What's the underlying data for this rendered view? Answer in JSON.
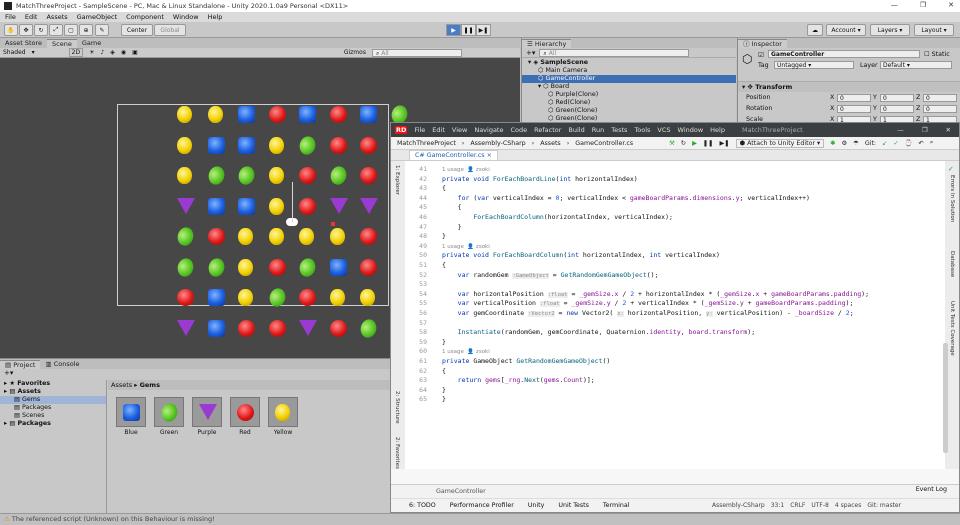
{
  "window": {
    "title": "MatchThreeProject - SampleScene - PC, Mac & Linux Standalone - Unity 2020.1.0a9 Personal <DX11>",
    "controls": [
      "—",
      "❐",
      "✕"
    ]
  },
  "menu": [
    "File",
    "Edit",
    "Assets",
    "GameObject",
    "Component",
    "Window",
    "Help"
  ],
  "toolbar": {
    "center": "Center",
    "global": "Global",
    "account": "Account",
    "layers": "Layers",
    "layout": "Layout"
  },
  "scene_panel": {
    "tabs": [
      "Asset Store",
      "Scene",
      "Game"
    ],
    "shading": "Shaded",
    "mode_2d": "2D",
    "gizmos": "Gizmos",
    "search_placeholder": "All"
  },
  "board": {
    "rows": [
      [
        "yellow",
        "yellow",
        "blue",
        "red",
        "blue",
        "red",
        "blue",
        "green"
      ],
      [
        "yellow",
        "blue",
        "blue",
        "yellow",
        "green",
        "red",
        "red",
        "green"
      ],
      [
        "yellow",
        "green",
        "green",
        "yellow",
        "red",
        "green",
        "red",
        "green"
      ],
      [
        "purple",
        "blue",
        "blue",
        "yellow",
        "red",
        "purple",
        "purple",
        "green"
      ],
      [
        "green",
        "red",
        "yellow",
        "yellow",
        "yellow",
        "yellow",
        "red",
        "blue"
      ],
      [
        "green",
        "green",
        "yellow",
        "red",
        "green",
        "blue",
        "red",
        "blue"
      ],
      [
        "red",
        "blue",
        "yellow",
        "green",
        "red",
        "yellow",
        "yellow",
        "red"
      ],
      [
        "purple",
        "blue",
        "red",
        "red",
        "purple",
        "red",
        "green",
        "yellow"
      ]
    ]
  },
  "hierarchy": {
    "tab": "Hierarchy",
    "search_placeholder": "All",
    "items": [
      {
        "label": "SampleScene",
        "depth": 0,
        "bold": true
      },
      {
        "label": "Main Camera",
        "depth": 1
      },
      {
        "label": "GameController",
        "depth": 1,
        "selected": true
      },
      {
        "label": "Board",
        "depth": 1
      },
      {
        "label": "Purple(Clone)",
        "depth": 2
      },
      {
        "label": "Red(Clone)",
        "depth": 2
      },
      {
        "label": "Green(Clone)",
        "depth": 2
      },
      {
        "label": "Green(Clone)",
        "depth": 2
      }
    ]
  },
  "inspector": {
    "tab": "Inspector",
    "object_name": "GameController",
    "static_label": "Static",
    "tag_label": "Tag",
    "tag_value": "Untagged",
    "layer_label": "Layer",
    "layer_value": "Default",
    "component": "Transform",
    "rows": [
      {
        "label": "Position",
        "x": "0",
        "y": "0",
        "z": "0"
      },
      {
        "label": "Rotation",
        "x": "0",
        "y": "0",
        "z": "0"
      },
      {
        "label": "Scale",
        "x": "1",
        "y": "1",
        "z": "1"
      }
    ],
    "axis": [
      "X",
      "Y",
      "Z"
    ]
  },
  "project": {
    "tabs": [
      "Project",
      "Console"
    ],
    "breadcrumb_root": "Assets",
    "breadcrumb_leaf": "Gems",
    "tree": [
      {
        "label": "Favorites",
        "bold": true,
        "depth": 0
      },
      {
        "label": "Assets",
        "bold": true,
        "depth": 0
      },
      {
        "label": "Gems",
        "depth": 1,
        "selected": true
      },
      {
        "label": "Packages",
        "depth": 1
      },
      {
        "label": "Scenes",
        "depth": 1
      },
      {
        "label": "Packages",
        "bold": true,
        "depth": 0
      }
    ],
    "assets": [
      {
        "name": "Blue",
        "color": "blue"
      },
      {
        "name": "Green",
        "color": "green"
      },
      {
        "name": "Purple",
        "color": "purple"
      },
      {
        "name": "Red",
        "color": "red"
      },
      {
        "name": "Yellow",
        "color": "yellow"
      }
    ]
  },
  "status_message": "The referenced script (Unknown) on this Behaviour is missing!",
  "ide": {
    "menu": [
      "File",
      "Edit",
      "View",
      "Navigate",
      "Code",
      "Refactor",
      "Build",
      "Run",
      "Tests",
      "Tools",
      "VCS",
      "Window",
      "Help"
    ],
    "project": "MatchThreeProject",
    "nav": [
      "MatchThreeProject",
      "Assembly-CSharp",
      "Assets",
      "GameController.cs"
    ],
    "run_config": "Attach to Unity Editor",
    "git_label": "Git:",
    "file_tab": "GameController.cs",
    "breadcrumb_bottom": "GameController",
    "bottom_tabs": [
      "6: TODO",
      "Performance Profiler",
      "Unity",
      "Unit Tests",
      "Terminal"
    ],
    "event_log": "Event Log",
    "status": {
      "assembly": "Assembly-CSharp",
      "pos": "33:1",
      "eol": "CRLF",
      "enc": "UTF-8",
      "indent": "4 spaces",
      "git": "Git: master"
    },
    "side_left": [
      "1: Explorer",
      "2: Structure",
      "2: Favorites"
    ],
    "side_right": [
      "Errors In Solution",
      "Database",
      "Unit Tests Coverage"
    ],
    "code": [
      {
        "n": "41",
        "html": "<span class='cm'>1 usage  &#x1F464; zsoki</span>"
      },
      {
        "n": "42",
        "html": "<span class='kw'>private void</span> <span class='fn'>ForEachBoardLine</span>(<span class='kw'>int</span> horizontalIndex)"
      },
      {
        "n": "43",
        "html": "{"
      },
      {
        "n": "44",
        "html": "    <span class='kw'>for</span> (<span class='kw'>var</span> verticalIndex = <span class='num'>0</span>; verticalIndex &lt; <span class='fld'>gameBoardParams</span>.<span class='fld'>dimensions</span>.<span class='fld'>y</span>; verticalIndex++)"
      },
      {
        "n": "45",
        "html": "    {"
      },
      {
        "n": "46",
        "html": "        <span class='fn'>ForEachBoardColumn</span>(horizontalIndex, verticalIndex);"
      },
      {
        "n": "47",
        "html": "    }"
      },
      {
        "n": "48",
        "html": "}"
      },
      {
        "n": "49",
        "html": "<span class='cm'>1 usage  &#x1F464; zsoki</span>"
      },
      {
        "n": "50",
        "html": "<span class='kw'>private void</span> <span class='fn'>ForEachBoardColumn</span>(<span class='kw'>int</span> horizontalIndex, <span class='kw'>int</span> verticalIndex)"
      },
      {
        "n": "51",
        "html": "{"
      },
      {
        "n": "52",
        "html": "    <span class='kw'>var</span> randomGem <span class='hint'>:GameObject</span> = <span class='fn'>GetRandomGemGameObject</span>();"
      },
      {
        "n": "53",
        "html": ""
      },
      {
        "n": "54",
        "html": "    <span class='kw'>var</span> horizontalPosition <span class='hint'>:float</span> = <span class='fld'>_gemSize</span>.<span class='fld'>x</span> / <span class='num'>2</span> + horizontalIndex * (<span class='fld'>_gemSize</span>.<span class='fld'>x</span> + <span class='fld'>gameBoardParams</span>.<span class='fld'>padding</span>);"
      },
      {
        "n": "55",
        "html": "    <span class='kw'>var</span> verticalPosition <span class='hint'>:float</span> = <span class='fld'>_gemSize</span>.<span class='fld'>y</span> / <span class='num'>2</span> + verticalIndex * (<span class='fld'>_gemSize</span>.<span class='fld'>y</span> + <span class='fld'>gameBoardParams</span>.<span class='fld'>padding</span>);"
      },
      {
        "n": "56",
        "html": "    <span class='kw'>var</span> gemCoordinate <span class='hint'>:Vector2</span> = <span class='kw'>new</span> Vector2( <span class='hint'>x:</span> horizontalPosition, <span class='hint'>y:</span> verticalPosition) - <span class='fld'>_boardSize</span> / <span class='num'>2</span>;"
      },
      {
        "n": "57",
        "html": ""
      },
      {
        "n": "58",
        "html": "    <span class='fn'>Instantiate</span>(randomGem, gemCoordinate, Quaternion.<span class='fld'>identity</span>, <span class='fld'>board</span>.<span class='fld'>transform</span>);"
      },
      {
        "n": "59",
        "html": "}"
      },
      {
        "n": "60",
        "html": "<span class='cm'>1 usage  &#x1F464; zsoki</span>"
      },
      {
        "n": "61",
        "html": "<span class='kw'>private</span> GameObject <span class='fn'>GetRandomGemGameObject</span>()"
      },
      {
        "n": "62",
        "html": "{"
      },
      {
        "n": "63",
        "html": "    <span class='kw'>return</span> <span class='fld'>gems</span>[<span class='fld'>_rng</span>.<span class='fn'>Next</span>(<span class='fld'>gems</span>.<span class='fld'>Count</span>)];"
      },
      {
        "n": "64",
        "html": "}"
      },
      {
        "n": "65",
        "html": "}"
      }
    ]
  }
}
